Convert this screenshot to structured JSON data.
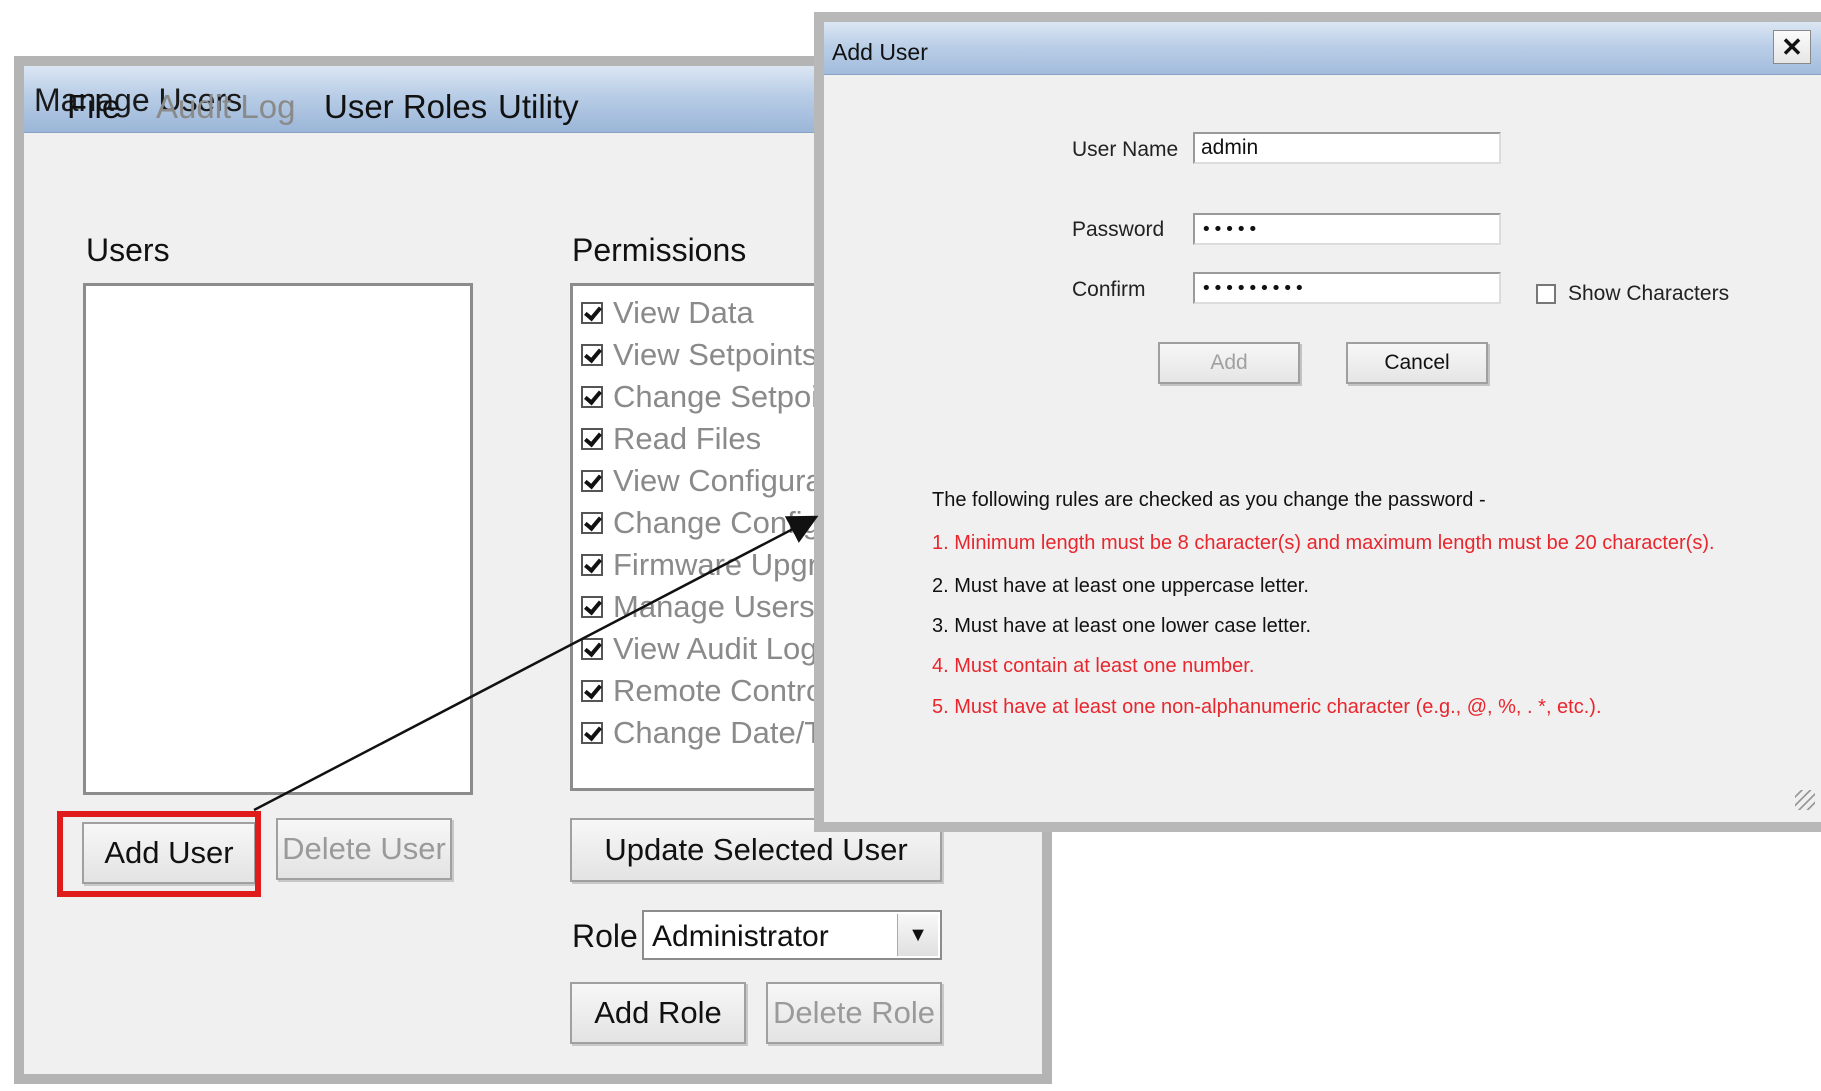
{
  "manage_users": {
    "title": "Manage Users",
    "menu": [
      "File",
      "Audit Log",
      "User Roles",
      "Utility"
    ],
    "users_label": "Users",
    "permissions_label": "Permissions",
    "permissions": [
      {
        "label": "View Data",
        "checked": true
      },
      {
        "label": "View Setpoints",
        "checked": true
      },
      {
        "label": "Change Setpoints",
        "checked": true
      },
      {
        "label": "Read Files",
        "checked": true
      },
      {
        "label": "View Configuration",
        "checked": true
      },
      {
        "label": "Change Configuration",
        "checked": true
      },
      {
        "label": "Firmware Upgrade",
        "checked": true
      },
      {
        "label": "Manage Users",
        "checked": true
      },
      {
        "label": "View Audit Log",
        "checked": true
      },
      {
        "label": "Remote Control",
        "checked": true
      },
      {
        "label": "Change Date/Time",
        "checked": true
      }
    ],
    "add_user_button": "Add User",
    "delete_user_button": "Delete User",
    "update_selected_user_button": "Update Selected User",
    "role_label": "Role",
    "role_value": "Administrator",
    "add_role_button": "Add Role",
    "delete_role_button": "Delete Role",
    "highlight_color": "#e01b1b"
  },
  "add_user_dialog": {
    "title": "Add User",
    "close_glyph": "✕",
    "user_name_label": "User Name",
    "user_name_value": "admin",
    "password_label": "Password",
    "password_value": "•••••",
    "confirm_label": "Confirm",
    "confirm_value": "•••••••••",
    "show_characters_label": "Show Characters",
    "show_characters_checked": false,
    "add_button": "Add",
    "cancel_button": "Cancel",
    "rules_header": "The following rules are checked as you change the password -",
    "rules": [
      {
        "text": "1. Minimum length must be 8 character(s) and maximum length must be 20 character(s).",
        "failed": true
      },
      {
        "text": "2. Must have at least one uppercase letter.",
        "failed": false
      },
      {
        "text": "3. Must have at least one lower case letter.",
        "failed": false
      },
      {
        "text": "4. Must contain at least one number.",
        "failed": true
      },
      {
        "text": "5. Must have at least one non-alphanumeric character (e.g., @, %, . *, etc.).",
        "failed": true
      }
    ],
    "failed_rule_color": "#e8262e"
  }
}
